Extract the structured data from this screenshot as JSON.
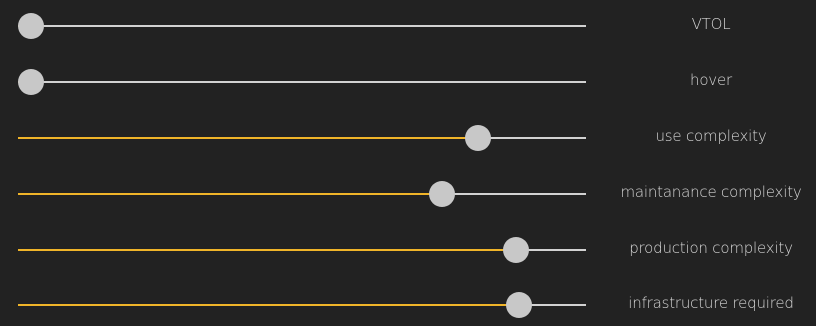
{
  "accent_color": "#f0b429",
  "track_color": "#d2d2d2",
  "thumb_color": "#c8c8c8",
  "background_color": "#222222",
  "sliders": [
    {
      "label": "VTOL",
      "value": 0.023
    },
    {
      "label": "hover",
      "value": 0.023
    },
    {
      "label": "use complexity",
      "value": 0.81
    },
    {
      "label": "maintanance complexity",
      "value": 0.747
    },
    {
      "label": "production complexity",
      "value": 0.877
    },
    {
      "label": "infrastructure required",
      "value": 0.882
    }
  ]
}
